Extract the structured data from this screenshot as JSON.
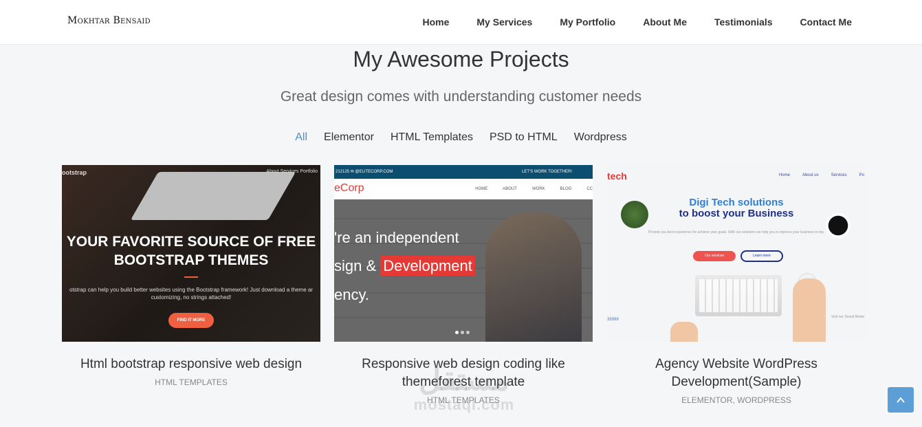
{
  "brand": "Mokhtar Bensaid",
  "nav": [
    "Home",
    "My Services",
    "My Portfolio",
    "About Me",
    "Testimonials",
    "Contact Me"
  ],
  "section": {
    "title": "My Awesome Projects",
    "subtitle": "Great design comes with understanding customer needs"
  },
  "filters": [
    {
      "label": "All",
      "active": true
    },
    {
      "label": "Elementor",
      "active": false
    },
    {
      "label": "HTML Templates",
      "active": false
    },
    {
      "label": "PSD to HTML",
      "active": false
    },
    {
      "label": "Wordpress",
      "active": false
    }
  ],
  "projects": [
    {
      "title": "Html bootstrap responsive web design",
      "category": "HTML TEMPLATES",
      "thumb": {
        "brand": "ootstrap",
        "nav": "About   Services   Portfolio",
        "headline": "YOUR FAVORITE SOURCE OF FREE BOOTSTRAP THEMES",
        "text": "otstrap can help you build better websites using the Bootstrap framework! Just download a theme ar customizing, no strings attached!",
        "button": "FIND IT MORE"
      }
    },
    {
      "title": "Responsive web design coding like themeforest template",
      "category": "HTML TEMPLATES",
      "thumb": {
        "topbar_left": "212125   ✉ @ELITECORP.COM",
        "topbar_right": "LET'S WORK TOGETHER!",
        "logo": "eCorp",
        "links": [
          "HOME",
          "ABOUT",
          "WORK",
          "BLOG",
          "CC"
        ],
        "line1": "'re an independent",
        "line2_pre": "sign & ",
        "line2_highlight": "Development",
        "line3": "ency."
      }
    },
    {
      "title": "Agency Website WordPress Development(Sample)",
      "category": "ELEMENTOR, WORDPRESS",
      "thumb": {
        "logo": "tech",
        "links": [
          "Home",
          "About us",
          "Services",
          "Po"
        ],
        "headline1": "Digi Tech solutions",
        "headline2": "to boost your Business",
        "small": "Provide you best experience for achieve your goals. With our solutions we help you to improve your business to top.",
        "btn1": "Our services",
        "btn2": "Learn more",
        "phone": "35999",
        "social": "Visit our Social Media"
      }
    }
  ],
  "watermark": {
    "arabic": "مستقل",
    "latin": "mostaql.com"
  },
  "back_to_top_icon": "chevron-up-icon",
  "colors": {
    "accent": "#4a90c8",
    "background": "#f5f6f8",
    "button": "#5c9ed6"
  }
}
